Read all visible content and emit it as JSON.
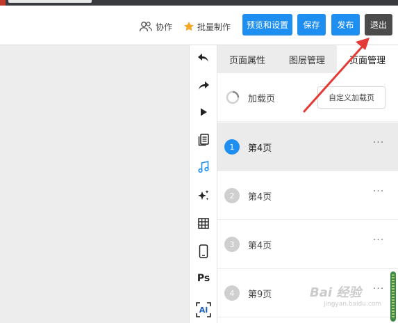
{
  "toolbar": {
    "collab_label": "协作",
    "batch_label": "批量制作",
    "preview_label": "预览和设置",
    "save_label": "保存",
    "publish_label": "发布",
    "exit_label": "退出"
  },
  "iconbar": {
    "items": [
      {
        "icon": "undo-icon"
      },
      {
        "icon": "redo-icon"
      },
      {
        "icon": "play-icon"
      },
      {
        "icon": "pages-icon"
      },
      {
        "icon": "music-icon"
      },
      {
        "icon": "sparkle-icon"
      },
      {
        "icon": "grid-icon"
      },
      {
        "icon": "phone-icon"
      },
      {
        "icon": "ps-icon",
        "label": "Ps"
      },
      {
        "icon": "ai-icon",
        "label": "AI"
      }
    ]
  },
  "panel": {
    "tabs": [
      {
        "label": "页面属性"
      },
      {
        "label": "图层管理"
      },
      {
        "label": "页面管理"
      }
    ],
    "load_page": {
      "label": "加载页",
      "custom_button": "自定义加载页"
    },
    "pages": [
      {
        "num": "1",
        "label": "第4页",
        "active": true
      },
      {
        "num": "2",
        "label": "第4页",
        "active": false
      },
      {
        "num": "3",
        "label": "第4页",
        "active": false
      },
      {
        "num": "4",
        "label": "第9页",
        "active": false
      }
    ],
    "more_label": "···"
  },
  "watermark": {
    "text": "Bai 经验",
    "sub": "jingyan.baidu.com"
  },
  "colors": {
    "accent": "#1f8ef1",
    "exit": "#4b4b4b",
    "arrow": "#e53935"
  }
}
